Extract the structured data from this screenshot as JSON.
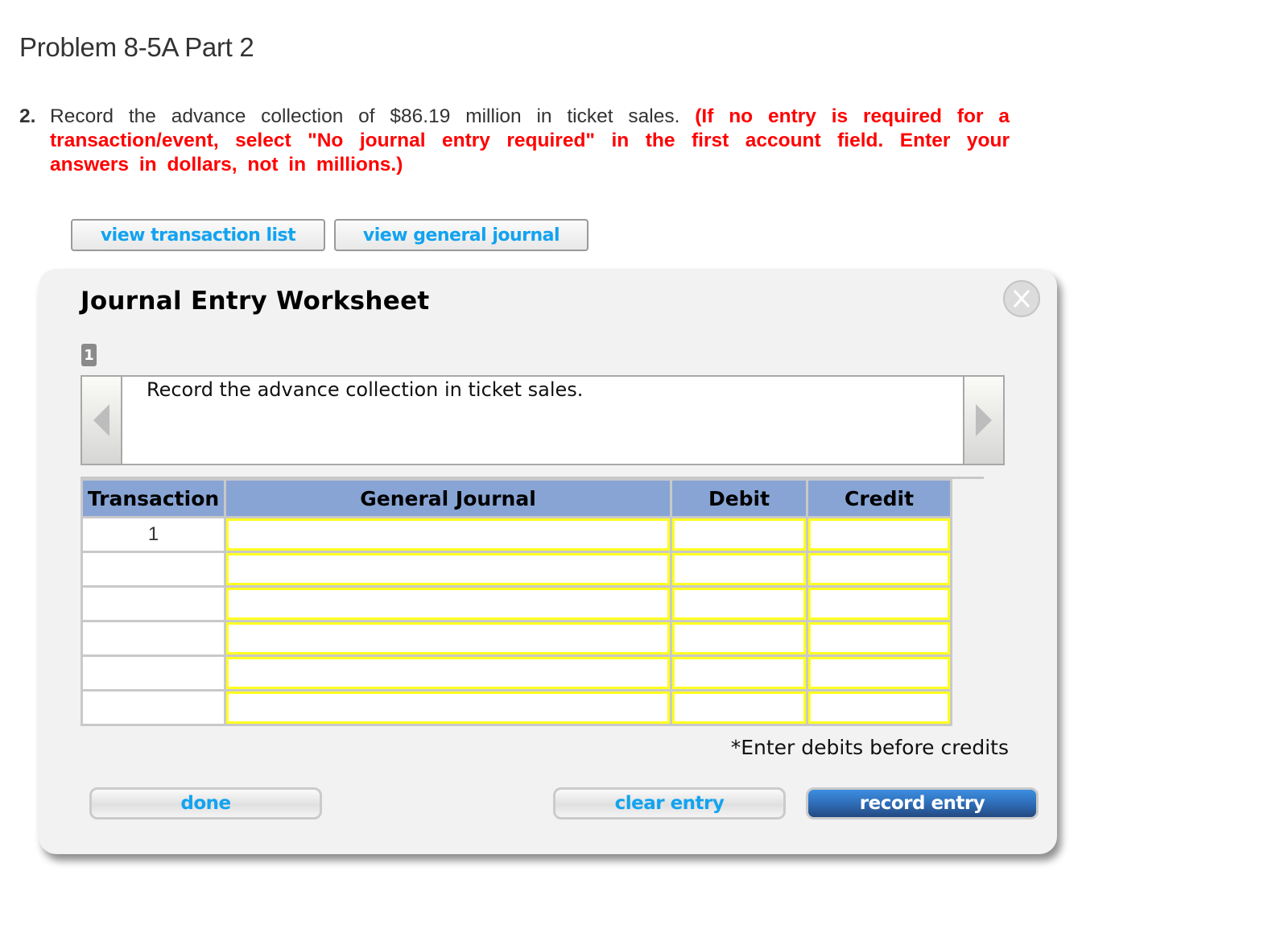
{
  "page": {
    "title": "Problem 8-5A Part 2"
  },
  "question": {
    "number": "2.",
    "text": "Record the advance collection of $86.19 million in ticket sales.",
    "note": "(If no entry is required for a transaction/event, select \"No journal entry required\" in the first account field. Enter your answers in dollars, not in millions.)",
    "note_color": "#ff0000"
  },
  "tabs": {
    "transaction_list": "view transaction list",
    "general_journal": "view general journal"
  },
  "worksheet": {
    "title": "Journal Entry Worksheet",
    "close_icon": "close-x-icon",
    "step_badge": "1",
    "description": "Record the advance collection in ticket sales.",
    "prev_icon": "left-triangle-icon",
    "next_icon": "right-triangle-icon",
    "table": {
      "headers": [
        "Transaction",
        "General Journal",
        "Debit",
        "Credit"
      ],
      "header_color": "#88a4d4",
      "input_border_color": "#ffff22",
      "rows": [
        {
          "transaction": "1",
          "account": "",
          "debit": "",
          "credit": ""
        },
        {
          "transaction": "",
          "account": "",
          "debit": "",
          "credit": ""
        },
        {
          "transaction": "",
          "account": "",
          "debit": "",
          "credit": ""
        },
        {
          "transaction": "",
          "account": "",
          "debit": "",
          "credit": ""
        },
        {
          "transaction": "",
          "account": "",
          "debit": "",
          "credit": ""
        },
        {
          "transaction": "",
          "account": "",
          "debit": "",
          "credit": ""
        }
      ]
    },
    "hint": "*Enter debits before credits",
    "buttons": {
      "done": "done",
      "clear": "clear entry",
      "record": "record entry"
    },
    "accent_color": "#12a3f0",
    "primary_button_color": "#2f6db8"
  }
}
